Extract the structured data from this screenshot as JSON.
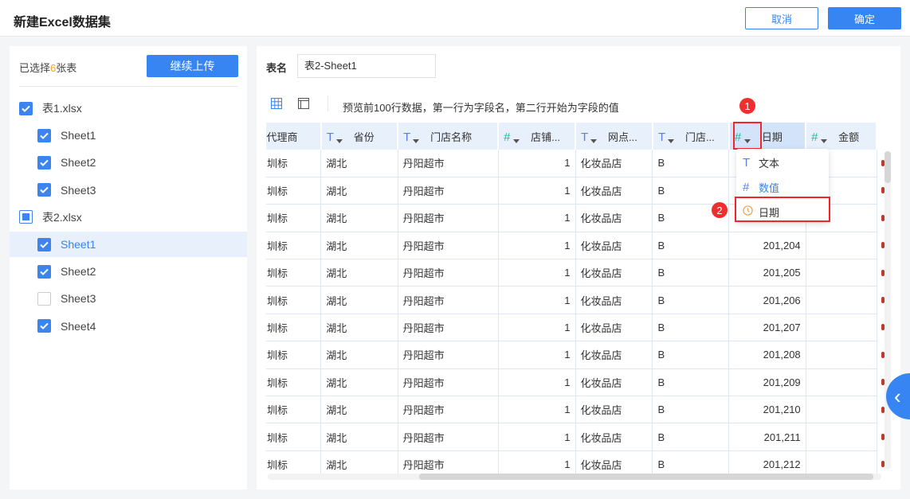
{
  "header": {
    "title": "新建Excel数据集",
    "cancel": "取消",
    "confirm": "确定"
  },
  "sidebar": {
    "selected_prefix": "已选择",
    "selected_count": "6",
    "selected_suffix": "张表",
    "upload": "继续上传",
    "items": [
      {
        "label": "表1.xlsx",
        "state": "checked",
        "level": 0
      },
      {
        "label": "Sheet1",
        "state": "checked",
        "level": 1
      },
      {
        "label": "Sheet2",
        "state": "checked",
        "level": 1
      },
      {
        "label": "Sheet3",
        "state": "checked",
        "level": 1
      },
      {
        "label": "表2.xlsx",
        "state": "partial",
        "level": 0
      },
      {
        "label": "Sheet1",
        "state": "checked",
        "level": 1,
        "active": true
      },
      {
        "label": "Sheet2",
        "state": "checked",
        "level": 1
      },
      {
        "label": "Sheet3",
        "state": "unchecked",
        "level": 1
      },
      {
        "label": "Sheet4",
        "state": "checked",
        "level": 1
      }
    ]
  },
  "main": {
    "table_name_label": "表名",
    "table_name": "表2-Sheet1",
    "hint": "预览前100行数据，第一行为字段名，第二行开始为字段的值"
  },
  "columns": [
    {
      "label": "代理商",
      "type": ""
    },
    {
      "label": "省份",
      "type": "T"
    },
    {
      "label": "门店名称",
      "type": "T"
    },
    {
      "label": "店铺...",
      "type": "#"
    },
    {
      "label": "网点...",
      "type": "T"
    },
    {
      "label": "门店...",
      "type": "T"
    },
    {
      "label": "日期",
      "type": "#"
    },
    {
      "label": "金额",
      "type": "#"
    }
  ],
  "rows": [
    [
      "圳标",
      "湖北",
      "丹阳超市",
      "1",
      "化妆品店",
      "B",
      ""
    ],
    [
      "圳标",
      "湖北",
      "丹阳超市",
      "1",
      "化妆品店",
      "B",
      ""
    ],
    [
      "圳标",
      "湖北",
      "丹阳超市",
      "1",
      "化妆品店",
      "B",
      ""
    ],
    [
      "圳标",
      "湖北",
      "丹阳超市",
      "1",
      "化妆品店",
      "B",
      "201,204"
    ],
    [
      "圳标",
      "湖北",
      "丹阳超市",
      "1",
      "化妆品店",
      "B",
      "201,205"
    ],
    [
      "圳标",
      "湖北",
      "丹阳超市",
      "1",
      "化妆品店",
      "B",
      "201,206"
    ],
    [
      "圳标",
      "湖北",
      "丹阳超市",
      "1",
      "化妆品店",
      "B",
      "201,207"
    ],
    [
      "圳标",
      "湖北",
      "丹阳超市",
      "1",
      "化妆品店",
      "B",
      "201,208"
    ],
    [
      "圳标",
      "湖北",
      "丹阳超市",
      "1",
      "化妆品店",
      "B",
      "201,209"
    ],
    [
      "圳标",
      "湖北",
      "丹阳超市",
      "1",
      "化妆品店",
      "B",
      "201,210"
    ],
    [
      "圳标",
      "湖北",
      "丹阳超市",
      "1",
      "化妆品店",
      "B",
      "201,211"
    ],
    [
      "圳标",
      "湖北",
      "丹阳超市",
      "1",
      "化妆品店",
      "B",
      "201,212"
    ]
  ],
  "type_menu": {
    "items": [
      {
        "icon": "T",
        "label": "文本"
      },
      {
        "icon": "#",
        "label": "数值"
      },
      {
        "icon": "clock",
        "label": "日期"
      }
    ]
  },
  "annotations": {
    "step1": "1",
    "step2": "2"
  }
}
